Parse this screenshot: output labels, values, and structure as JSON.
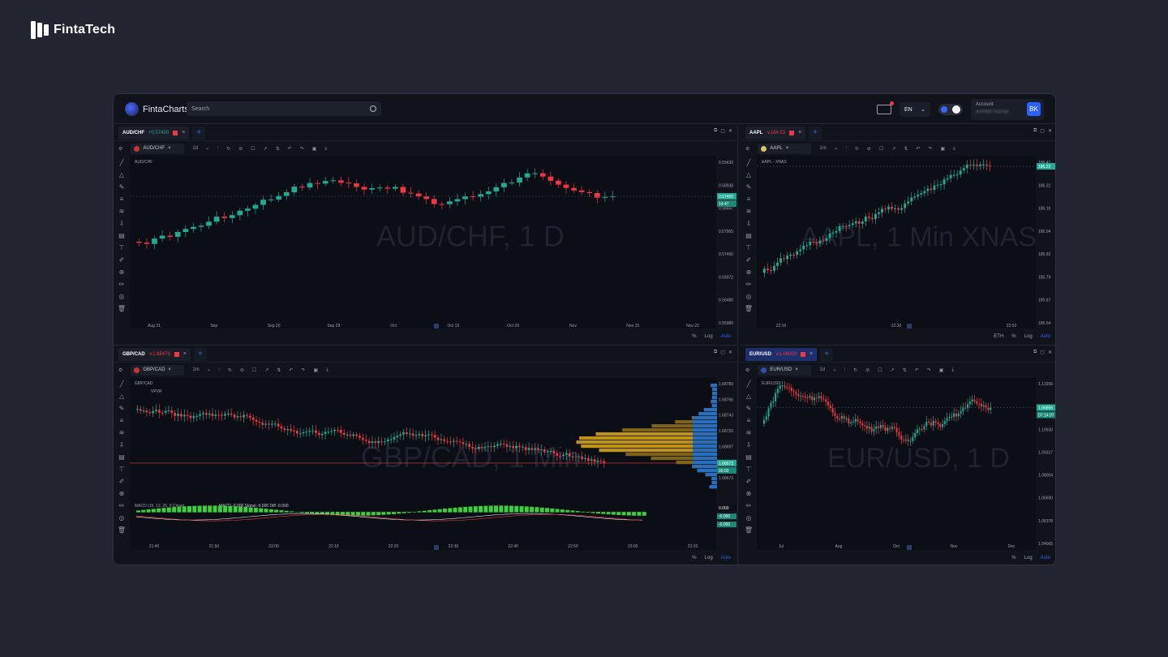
{
  "brand": {
    "name": "FintaTech"
  },
  "app": {
    "name": "FintaCharts",
    "search_placeholder": "Search",
    "lang": "EN",
    "account_label": "Account",
    "account_name": "Bohdan Kachyr",
    "avatar": "BK"
  },
  "toolbar": {
    "interval_1d": "1d",
    "interval_1m": "1m",
    "pct": "%",
    "log": "Log",
    "auto": "Auto",
    "eth": "ETH"
  },
  "panels": [
    {
      "id": "p1",
      "tab_symbol": "AUD/CHF",
      "tab_price": "+0.57400",
      "price_dir": "up",
      "search_symbol": "AUD/CHF",
      "interval": "1d",
      "legend": "AUD/CHF",
      "watermark": "AUD/CHF, 1 D",
      "y_ticks": [
        "0.59430",
        "0.58938",
        "0.58447",
        "0.57955",
        "0.57400",
        "0.56972",
        "0.56480",
        "0.55989"
      ],
      "price_tag": "0.57400",
      "timer": "14:47",
      "x_ticks": [
        "Aug 21",
        "Sep",
        "Sep 20",
        "Sep 29",
        "Oct",
        "Oct 19",
        "Oct 29",
        "Nov",
        "Nov 15",
        "Nov 22"
      ]
    },
    {
      "id": "p2",
      "tab_symbol": "AAPL",
      "tab_price": "∨184.53",
      "price_dir": "dn",
      "search_symbol": "AAPL",
      "interval": "1m",
      "legend": "AAPL - XNAS",
      "watermark": "AAPL, 1 Min XNAS",
      "y_ticks": [
        "186.41",
        "186.22",
        "186.16",
        "186.04",
        "185.92",
        "185.79",
        "185.67",
        "185.54"
      ],
      "price_tag": "186.22",
      "x_ticks": [
        "22:10",
        "22:30",
        "22:50"
      ]
    },
    {
      "id": "p3",
      "tab_symbol": "GBP/CAD",
      "tab_price": "∨1.68473",
      "price_dir": "dn",
      "search_symbol": "GBP/CAD",
      "interval": "1m",
      "legend": "GBP/CAD",
      "indicator": "VPVR",
      "watermark": "GBP/CAD, 1 Min",
      "y_ticks": [
        "1.68789",
        "1.68766",
        "1.68743",
        "1.68720",
        "1.68697",
        "1.68683",
        "1.68673"
      ],
      "price_tag": "1.68673",
      "timer": "00:00",
      "macd_legend": "MACD (15, 12, 26, 9 Close)",
      "macd_vals": "MACD -0.000 Signal -0.000 Diff -0.000",
      "macd_ticks": [
        "0.000",
        "-0.000",
        "-0.000"
      ],
      "x_ticks": [
        "21:40",
        "21:50",
        "22:00",
        "22:10",
        "22:20",
        "22:30",
        "22:40",
        "22:50",
        "23:00",
        "23:10"
      ]
    },
    {
      "id": "p4",
      "tab_symbol": "EUR/USD",
      "tab_price": "∨1.06000",
      "price_dir": "dn",
      "search_symbol": "EUR/USD",
      "interval": "1d",
      "legend": "EUR/USD",
      "watermark": "EUR/USD, 1 D",
      "y_ticks": [
        "1.13256",
        "1.11943",
        "1.10630",
        "1.09317",
        "1.08004",
        "1.06690",
        "1.05378",
        "1.04065"
      ],
      "price_tag": "1.06856",
      "timer": "07:14:07",
      "x_ticks": [
        "Jul",
        "Aug",
        "Oct",
        "Nov",
        "Dec"
      ]
    }
  ],
  "colors": {
    "up": "#22ab94",
    "down": "#f23645",
    "accent": "#2962ff",
    "bg": "#10131a",
    "panel": "#0b0e14"
  }
}
